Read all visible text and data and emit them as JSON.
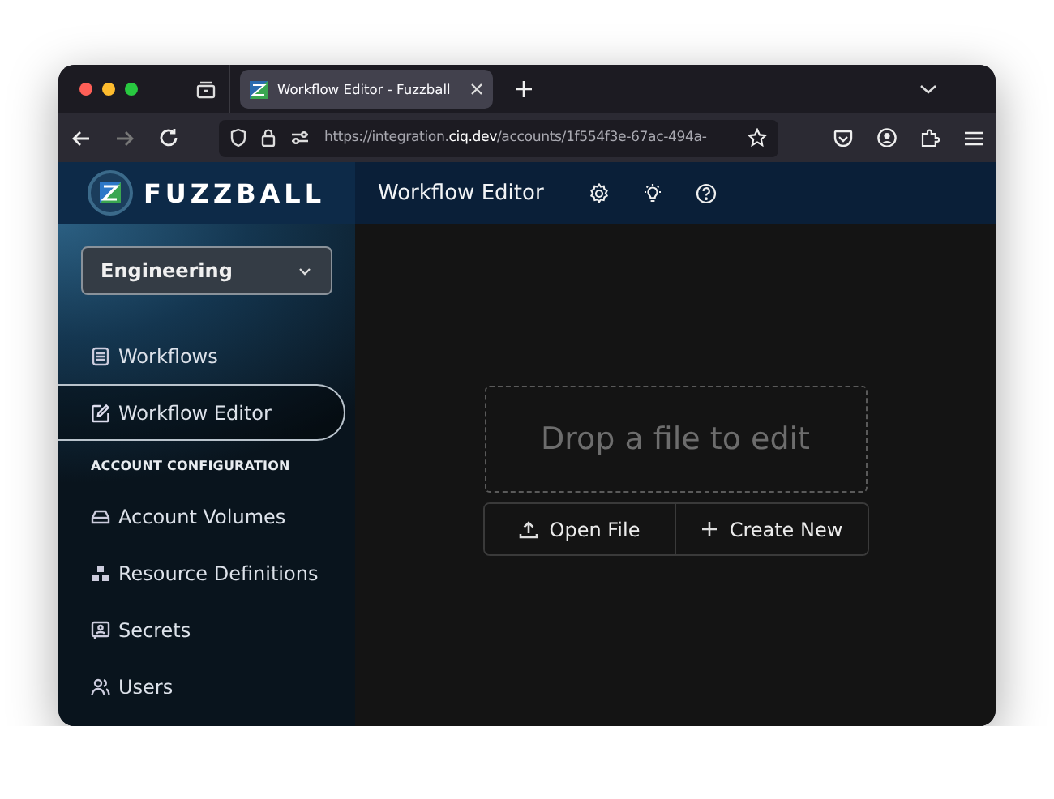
{
  "browser": {
    "tab": {
      "title": "Workflow Editor - Fuzzball",
      "selected": true
    },
    "url": "https://integration.**ciq.dev**/accounts/1f554f3e-67ac-494a-"
  },
  "app": {
    "logo": "FUZZBALL",
    "header_title": "Workflow Editor",
    "account_select": {
      "value": "Engineering"
    },
    "nav": [
      {
        "label": "Workflows",
        "selected": false
      },
      {
        "label": "Workflow Editor",
        "selected": true
      }
    ],
    "section_heading": "ACCOUNT CONFIGURATION",
    "config_nav": [
      {
        "label": "Account Volumes",
        "selected": false
      },
      {
        "label": "Resource Definitions",
        "selected": false
      },
      {
        "label": "Secrets",
        "selected": false
      },
      {
        "label": "Users",
        "selected": false
      }
    ],
    "dropzone": "Drop a file to edit",
    "buttons": [
      {
        "label": "Open File"
      },
      {
        "label": "Create New"
      }
    ]
  }
}
